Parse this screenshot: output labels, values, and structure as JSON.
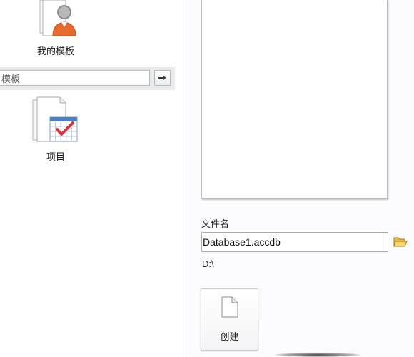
{
  "templates": {
    "my_templates": {
      "label": "我的模板",
      "icon": "user-template-icon"
    },
    "project": {
      "label": "项目",
      "icon": "calendar-template-icon"
    }
  },
  "search": {
    "value": "模板",
    "button_icon": "arrow-right-icon"
  },
  "new_database": {
    "filename_label": "文件名",
    "filename_value": "Database1.accdb",
    "browse_icon": "folder-open-icon",
    "path": "D:\\",
    "create_label": "创建",
    "create_icon": "blank-document-icon"
  },
  "colors": {
    "accent_orange": "#e86a2c",
    "checkmark_red": "#d8343a",
    "calendar_blue": "#4a7fc1",
    "search_strip_bg": "#e9eaec"
  }
}
